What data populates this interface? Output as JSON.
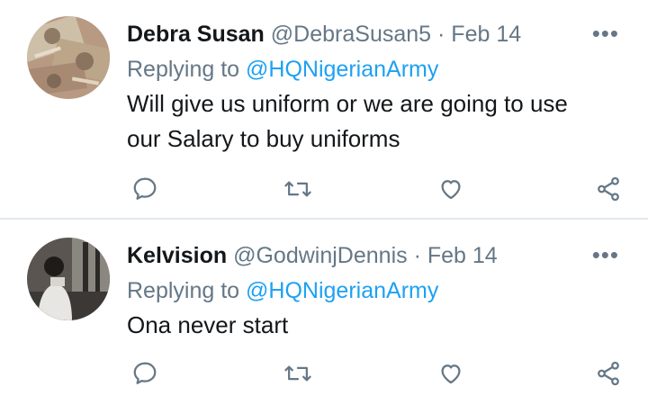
{
  "tweets": [
    {
      "name": "Debra Susan",
      "handle": "@DebraSusan5",
      "separator": "·",
      "date": "Feb 14",
      "reply_prefix": "Replying to",
      "reply_to": "@HQNigerianArmy",
      "text_line1": "Will give us uniform or we are going to use",
      "text_line2": "our Salary to buy uniforms",
      "more_label": "•••",
      "avatar_icon": "money-avatar-image"
    },
    {
      "name": "Kelvision",
      "handle": "@GodwinjDennis",
      "separator": "·",
      "date": "Feb 14",
      "reply_prefix": "Replying to",
      "reply_to": "@HQNigerianArmy",
      "text_line1": "Ona never start",
      "more_label": "•••",
      "avatar_icon": "person-avatar-image"
    }
  ],
  "actions": [
    "reply-icon",
    "retweet-icon",
    "like-icon",
    "share-icon"
  ],
  "colors": {
    "link": "#1da1f2",
    "muted": "#657786",
    "text": "#14171a",
    "divider": "#e1e8ed"
  }
}
